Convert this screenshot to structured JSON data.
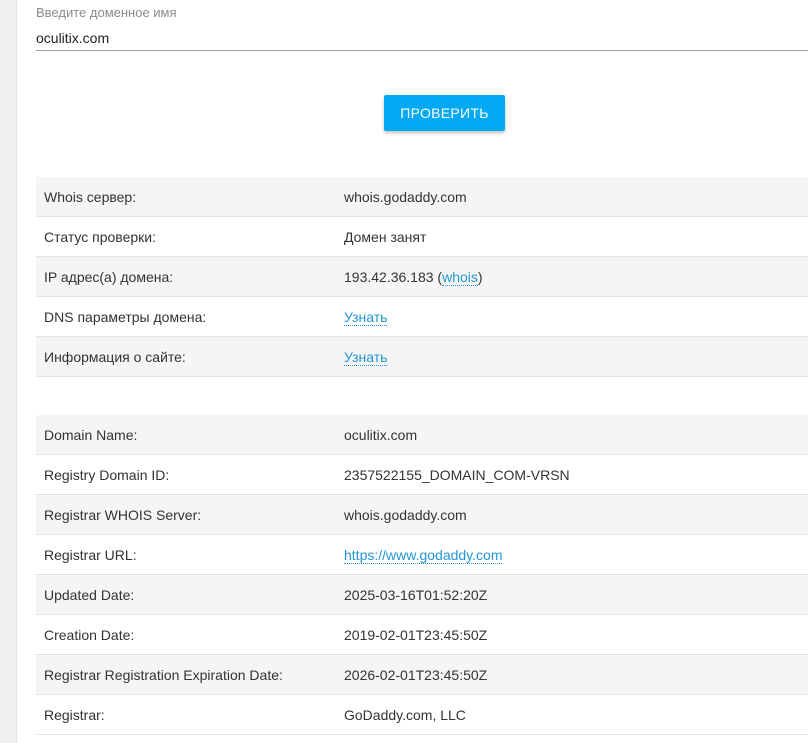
{
  "form": {
    "label": "Введите доменное имя",
    "domain_value": "oculitix.com",
    "check_button": "ПРОВЕРИТЬ"
  },
  "status_table": {
    "rows": [
      {
        "key": "Whois сервер:",
        "value": "whois.godaddy.com"
      },
      {
        "key": "Статус проверки:",
        "value": "Домен занят"
      },
      {
        "key": "IP адрес(а) домена:",
        "value": "193.42.36.183",
        "link": "whois",
        "prefix": "(",
        "suffix": ")"
      },
      {
        "key": "DNS параметры домена:",
        "link": "Узнать"
      },
      {
        "key": "Информация о сайте:",
        "link": "Узнать"
      }
    ]
  },
  "whois_table": {
    "rows": [
      {
        "key": "Domain Name:",
        "value": "oculitix.com"
      },
      {
        "key": "Registry Domain ID:",
        "value": "2357522155_DOMAIN_COM-VRSN"
      },
      {
        "key": "Registrar WHOIS Server:",
        "value": "whois.godaddy.com"
      },
      {
        "key": "Registrar URL:",
        "link": "https://www.godaddy.com"
      },
      {
        "key": "Updated Date:",
        "value": "2025-03-16T01:52:20Z"
      },
      {
        "key": "Creation Date:",
        "value": "2019-02-01T23:45:50Z"
      },
      {
        "key": "Registrar Registration Expiration Date:",
        "value": "2026-02-01T23:45:50Z"
      },
      {
        "key": "Registrar:",
        "value": "GoDaddy.com, LLC"
      }
    ]
  },
  "colors": {
    "accent": "#00a9f2",
    "link": "#2196d6",
    "row_stripe": "#f5f5f5"
  }
}
